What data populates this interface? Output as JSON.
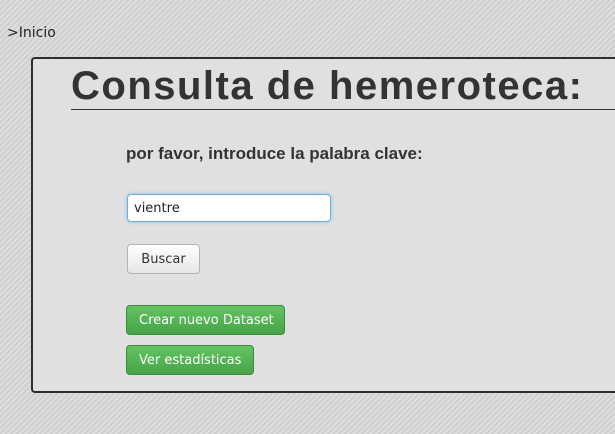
{
  "breadcrumb": {
    "link_text": ">Inicio"
  },
  "page": {
    "title": "Consulta de hemeroteca:",
    "prompt": "por favor, introduce la palabra clave:"
  },
  "search": {
    "value": "vientre",
    "button_label": "Buscar"
  },
  "actions": {
    "create_dataset_label": "Crear nuevo Dataset",
    "stats_label": "Ver estadísticas"
  },
  "colors": {
    "success": "#5cb85c",
    "input_focus": "#66afe9",
    "panel_bg": "#e0e0e0"
  }
}
